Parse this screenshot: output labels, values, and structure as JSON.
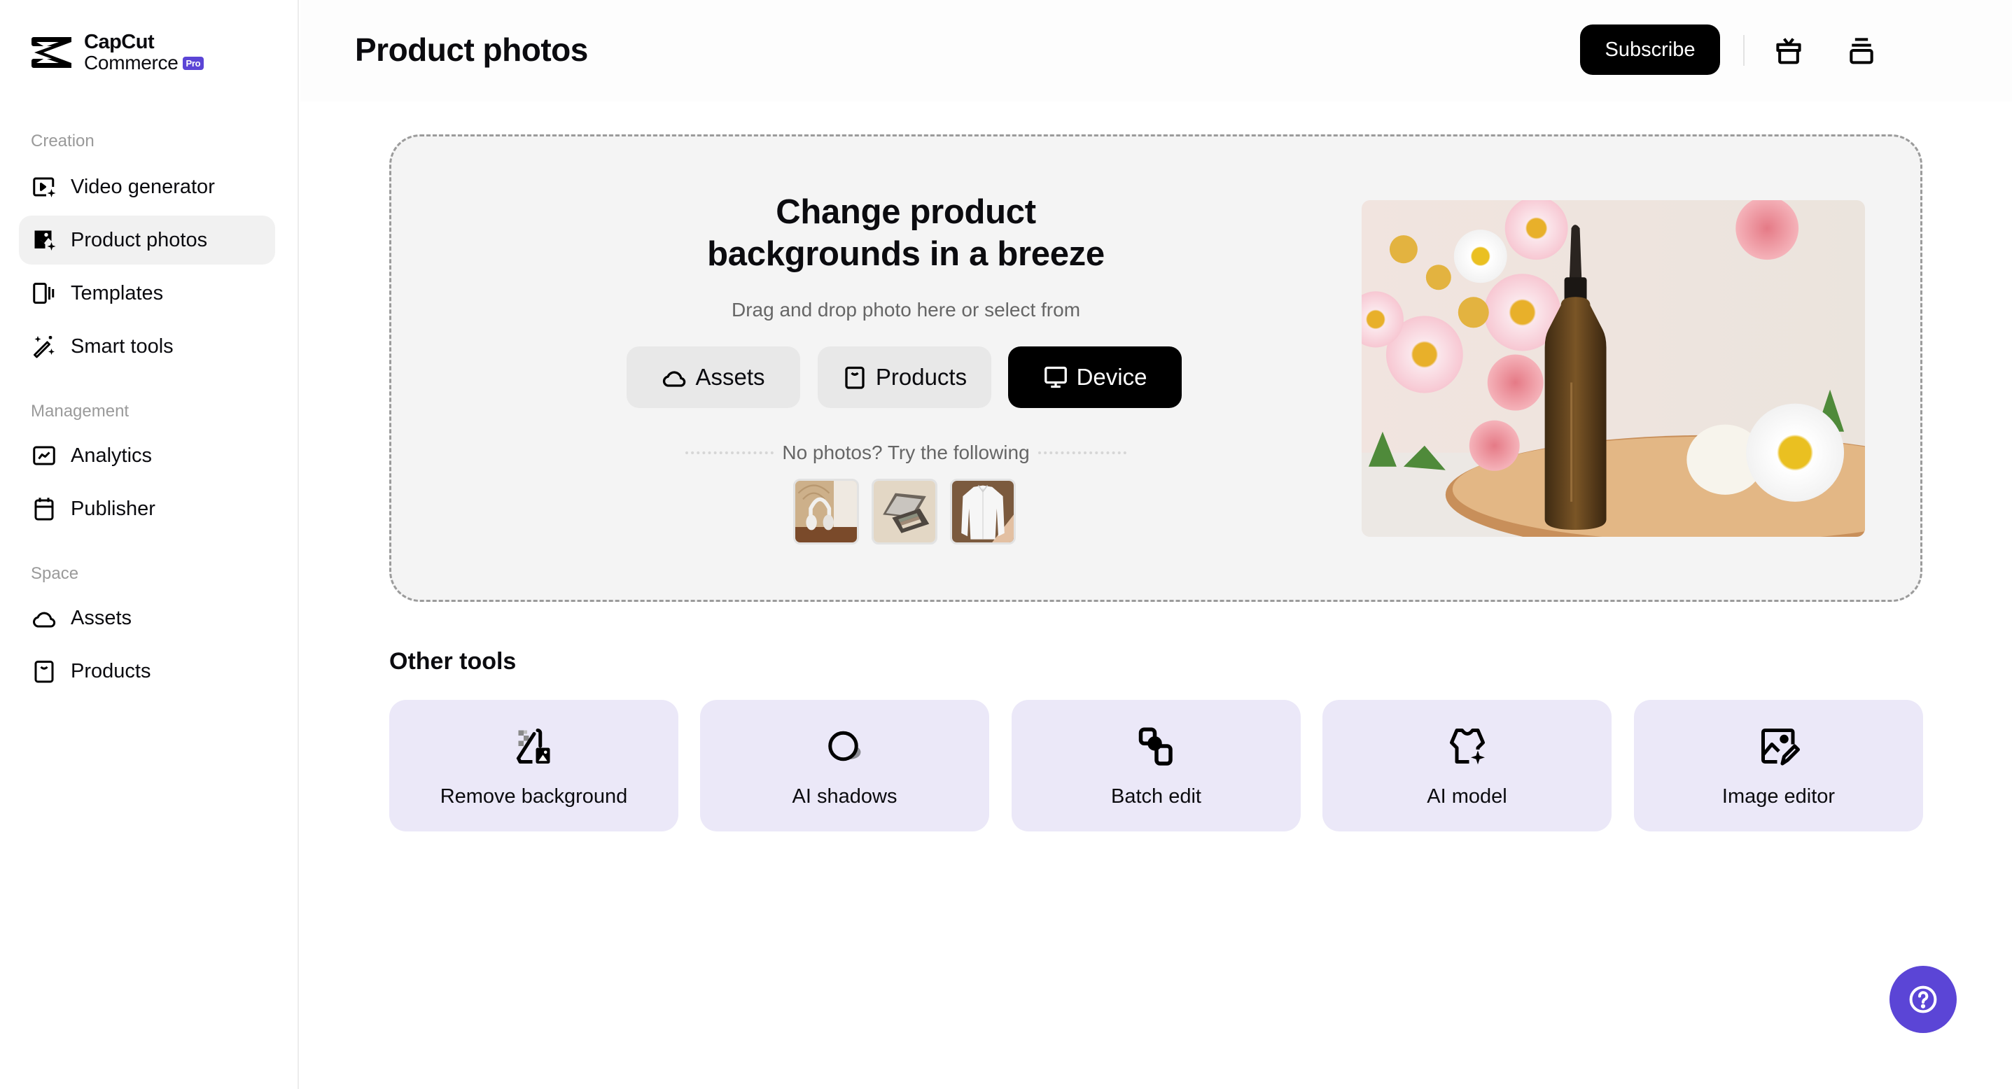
{
  "brand": {
    "name_line1": "CapCut",
    "name_line2": "Commerce",
    "badge": "Pro",
    "accent_color": "#5b45d6"
  },
  "sidebar": {
    "sections": [
      {
        "label": "Creation",
        "items": [
          {
            "label": "Video generator",
            "icon": "video-sparkle-icon",
            "active": false
          },
          {
            "label": "Product photos",
            "icon": "image-sparkle-icon",
            "active": true
          },
          {
            "label": "Templates",
            "icon": "templates-icon",
            "active": false
          },
          {
            "label": "Smart tools",
            "icon": "magic-wand-icon",
            "active": false
          }
        ]
      },
      {
        "label": "Management",
        "items": [
          {
            "label": "Analytics",
            "icon": "analytics-chart-icon",
            "active": false
          },
          {
            "label": "Publisher",
            "icon": "calendar-icon",
            "active": false
          }
        ]
      },
      {
        "label": "Space",
        "items": [
          {
            "label": "Assets",
            "icon": "cloud-icon",
            "active": false
          },
          {
            "label": "Products",
            "icon": "shopping-bag-icon",
            "active": false
          }
        ]
      }
    ]
  },
  "header": {
    "title": "Product photos",
    "subscribe_label": "Subscribe",
    "icons": [
      "gift-icon",
      "stack-icon"
    ]
  },
  "upload": {
    "heading_line1": "Change product",
    "heading_line2": "backgrounds in a breeze",
    "subtitle": "Drag and drop photo here or select from",
    "sources": [
      {
        "label": "Assets",
        "icon": "cloud-icon",
        "primary": false
      },
      {
        "label": "Products",
        "icon": "shopping-bag-icon",
        "primary": false
      },
      {
        "label": "Device",
        "icon": "monitor-icon",
        "primary": true
      }
    ],
    "try_text": "No photos? Try the following",
    "samples": [
      "headphones",
      "eyeshadow-palette",
      "white-shirt"
    ],
    "hero_image": "amber dropper bottle on wooden tray with daisies and roses"
  },
  "other_tools": {
    "title": "Other tools",
    "tools": [
      {
        "label": "Remove background",
        "icon": "remove-background-icon"
      },
      {
        "label": "AI shadows",
        "icon": "ai-shadow-icon"
      },
      {
        "label": "Batch edit",
        "icon": "batch-edit-icon"
      },
      {
        "label": "AI model",
        "icon": "ai-model-shirt-icon"
      },
      {
        "label": "Image editor",
        "icon": "image-edit-icon"
      }
    ]
  },
  "help": {
    "icon": "help-question-icon"
  }
}
